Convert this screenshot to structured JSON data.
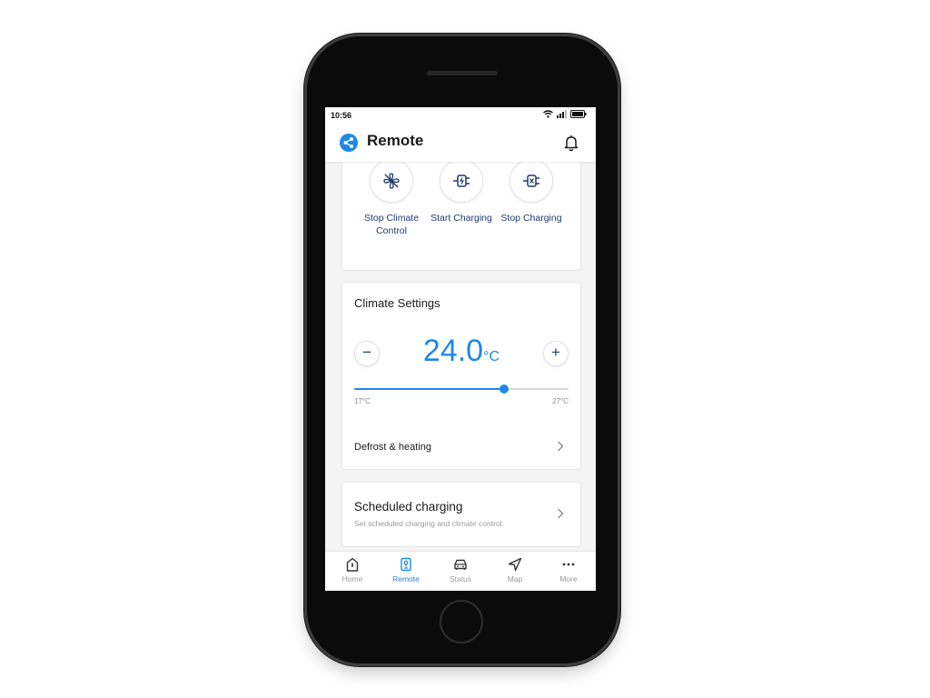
{
  "status_bar": {
    "time": "10:56"
  },
  "header": {
    "title": "Remote"
  },
  "quick_actions": [
    {
      "label": "Stop Climate Control",
      "icon": "fan-off-icon"
    },
    {
      "label": "Start Charging",
      "icon": "plug-charge-icon"
    },
    {
      "label": "Stop Charging",
      "icon": "plug-stop-icon"
    }
  ],
  "climate": {
    "title": "Climate Settings",
    "temperature": "24.0",
    "unit": "°C",
    "decrease": "−",
    "increase": "+",
    "min_label": "17°C",
    "max_label": "27°C",
    "slider_fraction": 0.7,
    "defrost_label": "Defrost & heating"
  },
  "schedule": {
    "title": "Scheduled charging",
    "subtitle": "Set scheduled charging and climate control."
  },
  "nav": {
    "home": "Home",
    "remote": "Remote",
    "status": "Status",
    "map": "Map",
    "more": "More",
    "active": "Remote"
  },
  "colors": {
    "accent": "#1e88e5",
    "navy": "#1f3a6e"
  }
}
